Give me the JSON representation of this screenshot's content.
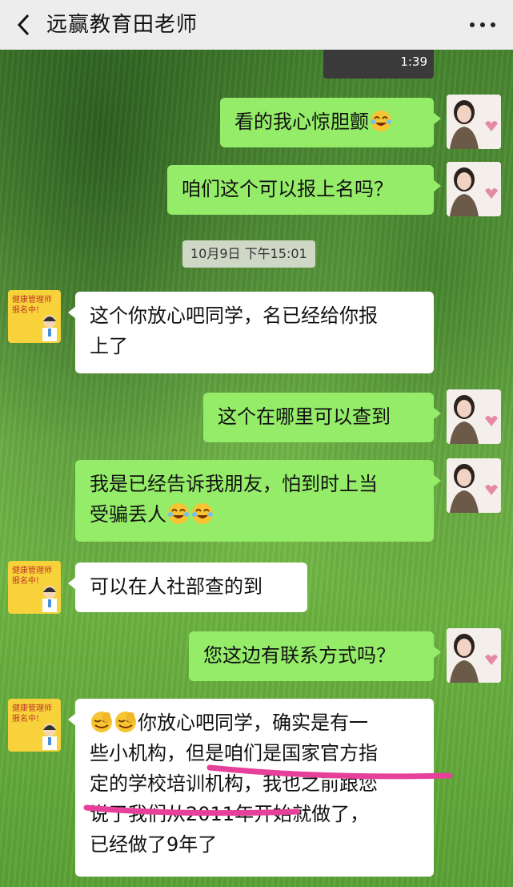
{
  "header": {
    "title": "远赢教育田老师"
  },
  "video": {
    "duration": "1:39"
  },
  "timestamp": "10月9日 下午15:01",
  "messages": [
    {
      "side": "right",
      "text": "看的我心惊胆颤"
    },
    {
      "side": "right",
      "text": "咱们这个可以报上名吗？"
    },
    {
      "side": "left",
      "line1": "这个你放心吧同学，名已经给你报",
      "line2": "上了"
    },
    {
      "side": "right",
      "text": "这个在哪里可以查到"
    },
    {
      "side": "right",
      "line1": "我是已经告诉我朋友，怕到时上当",
      "line2": "受骗丢人"
    },
    {
      "side": "left",
      "text": "可以在人社部查的到"
    },
    {
      "side": "right",
      "text": "您这边有联系方式吗？"
    },
    {
      "side": "left",
      "line1": "你放心吧同学，确实是有一",
      "line2": "些小机构，但是咱们是国家官方指",
      "line3": "定的学校培训机构，我也之前跟您",
      "line4": "说了我们从2011年开始就做了，",
      "line5": "已经做了9年了"
    }
  ],
  "left_avatar": {
    "line1": "健康管理师",
    "line2": "报名中!"
  },
  "colors": {
    "right_bubble": "#95ec69",
    "left_bubble": "#ffffff",
    "header_bg": "#ededed",
    "highlight_stroke": "#e6409a"
  }
}
